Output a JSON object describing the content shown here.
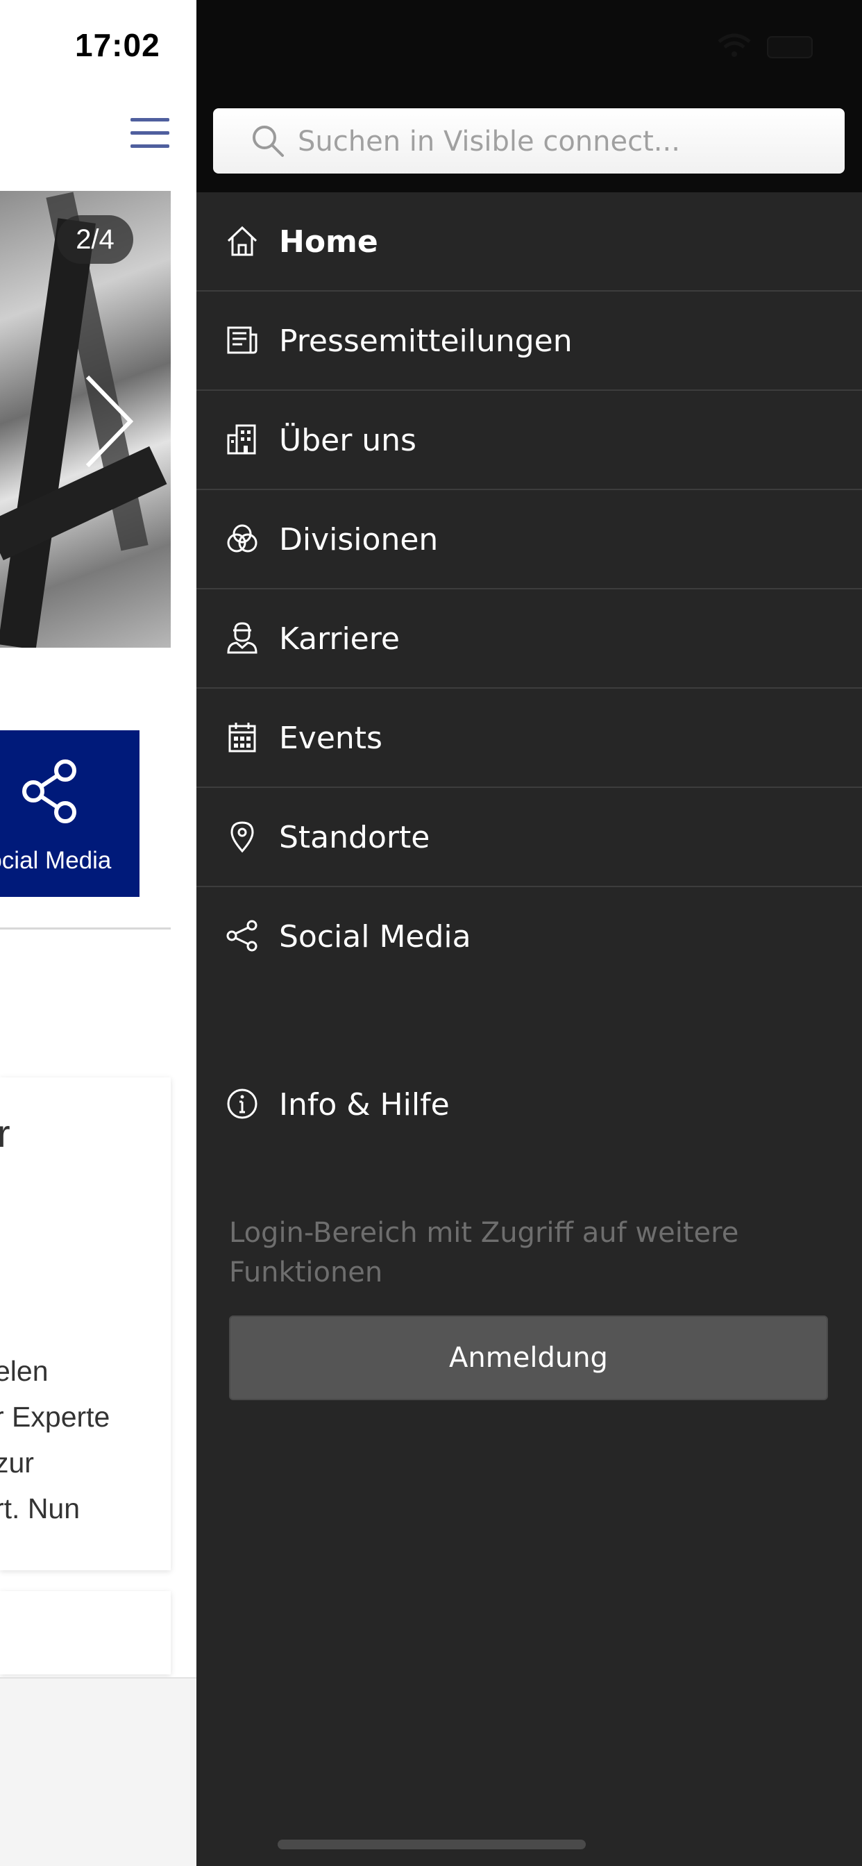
{
  "status_bar": {
    "time": "17:02"
  },
  "slider": {
    "counter": "2/4"
  },
  "share_tile": {
    "label": "Social Media"
  },
  "card": {
    "title_fragment": "r",
    "text_fragment": "elen\nr Experte\nzur\nrt. Nun"
  },
  "drawer": {
    "search": {
      "placeholder": "Suchen in Visible connect..."
    },
    "menu": [
      {
        "label": "Home",
        "icon": "home-icon",
        "active": true
      },
      {
        "label": "Pressemitteilungen",
        "icon": "newspaper-icon"
      },
      {
        "label": "Über uns",
        "icon": "building-icon"
      },
      {
        "label": "Divisionen",
        "icon": "divisions-icon"
      },
      {
        "label": "Karriere",
        "icon": "person-icon"
      },
      {
        "label": "Events",
        "icon": "calendar-icon"
      },
      {
        "label": "Standorte",
        "icon": "map-pin-icon"
      },
      {
        "label": "Social Media",
        "icon": "share-icon"
      }
    ],
    "info": {
      "label": "Info & Hilfe",
      "icon": "info-icon"
    },
    "login_hint": "Login-Bereich mit Zugriff auf weitere Funktionen",
    "login_button": "Anmeldung"
  },
  "colors": {
    "drawer_bg": "#262626",
    "accent_blue": "#001a7a",
    "hamburger": "#4f5f9e"
  }
}
